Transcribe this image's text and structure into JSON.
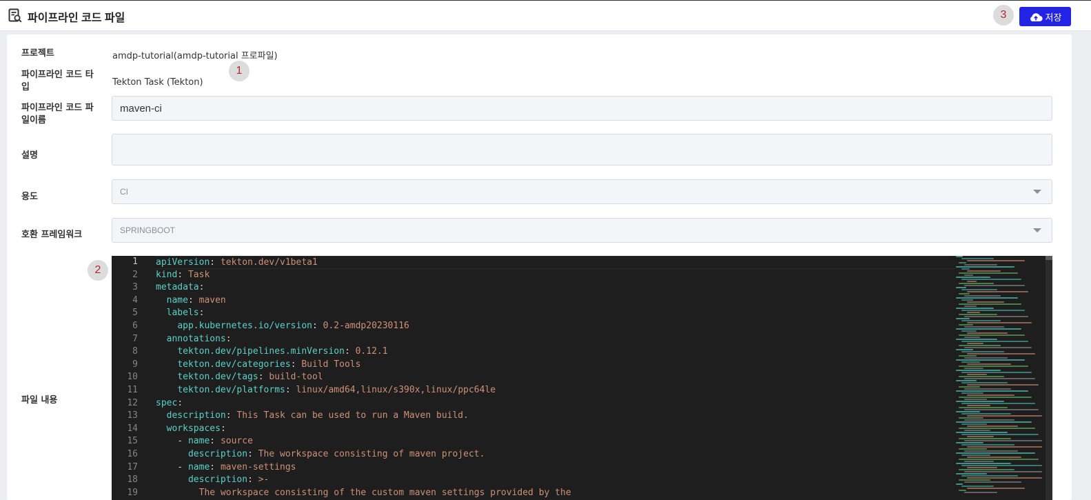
{
  "header": {
    "title": "파이프라인 코드 파일",
    "save_label": "저장",
    "badge_save": "3"
  },
  "form": {
    "project_label": "프로젝트",
    "project_value": "amdp-tutorial(amdp-tutorial 프로파일)",
    "badge_project": "1",
    "type_label": "파이프라인 코드 타입",
    "type_label_l1": "파이프라인 코드 타",
    "type_label_l2": "입",
    "type_value": "Tekton Task (Tekton)",
    "filename_label_l1": "파이프라인 코드 파",
    "filename_label_l2": "일이름",
    "filename_value": "maven-ci",
    "description_label": "설명",
    "description_value": "",
    "usage_label": "용도",
    "usage_value": "CI",
    "framework_label": "호환 프레임워크",
    "framework_value": "SPRINGBOOT",
    "content_label": "파일 내용",
    "badge_editor": "2"
  },
  "editor": {
    "lines": [
      {
        "n": "1",
        "indent": "",
        "key": "apiVersion",
        "sep": ": ",
        "val": "tekton.dev/v1beta1"
      },
      {
        "n": "2",
        "indent": "",
        "key": "kind",
        "sep": ": ",
        "val": "Task"
      },
      {
        "n": "3",
        "indent": "",
        "key": "metadata",
        "sep": ":",
        "val": ""
      },
      {
        "n": "4",
        "indent": "  ",
        "key": "name",
        "sep": ": ",
        "val": "maven"
      },
      {
        "n": "5",
        "indent": "  ",
        "key": "labels",
        "sep": ":",
        "val": ""
      },
      {
        "n": "6",
        "indent": "    ",
        "key": "app.kubernetes.io/version",
        "sep": ": ",
        "val": "0.2-amdp20230116"
      },
      {
        "n": "7",
        "indent": "  ",
        "key": "annotations",
        "sep": ":",
        "val": ""
      },
      {
        "n": "8",
        "indent": "    ",
        "key": "tekton.dev/pipelines.minVersion",
        "sep": ": ",
        "val": "0.12.1"
      },
      {
        "n": "9",
        "indent": "    ",
        "key": "tekton.dev/categories",
        "sep": ": ",
        "val": "Build Tools"
      },
      {
        "n": "10",
        "indent": "    ",
        "key": "tekton.dev/tags",
        "sep": ": ",
        "val": "build-tool"
      },
      {
        "n": "11",
        "indent": "    ",
        "key": "tekton.dev/platforms",
        "sep": ": ",
        "val": "linux/amd64,linux/s390x,linux/ppc64le"
      },
      {
        "n": "12",
        "indent": "",
        "key": "spec",
        "sep": ":",
        "val": ""
      },
      {
        "n": "13",
        "indent": "  ",
        "key": "description",
        "sep": ": ",
        "val": "This Task can be used to run a Maven build."
      },
      {
        "n": "14",
        "indent": "  ",
        "key": "workspaces",
        "sep": ":",
        "val": ""
      },
      {
        "n": "15",
        "indent": "    - ",
        "key": "name",
        "sep": ": ",
        "val": "source"
      },
      {
        "n": "16",
        "indent": "      ",
        "key": "description",
        "sep": ": ",
        "val": "The workspace consisting of maven project."
      },
      {
        "n": "17",
        "indent": "    - ",
        "key": "name",
        "sep": ": ",
        "val": "maven-settings"
      },
      {
        "n": "18",
        "indent": "      ",
        "key": "description",
        "sep": ": ",
        "val": ">-"
      },
      {
        "n": "19",
        "indent": "        ",
        "key": "",
        "sep": "",
        "val": "The workspace consisting of the custom maven settings provided by the"
      }
    ]
  }
}
